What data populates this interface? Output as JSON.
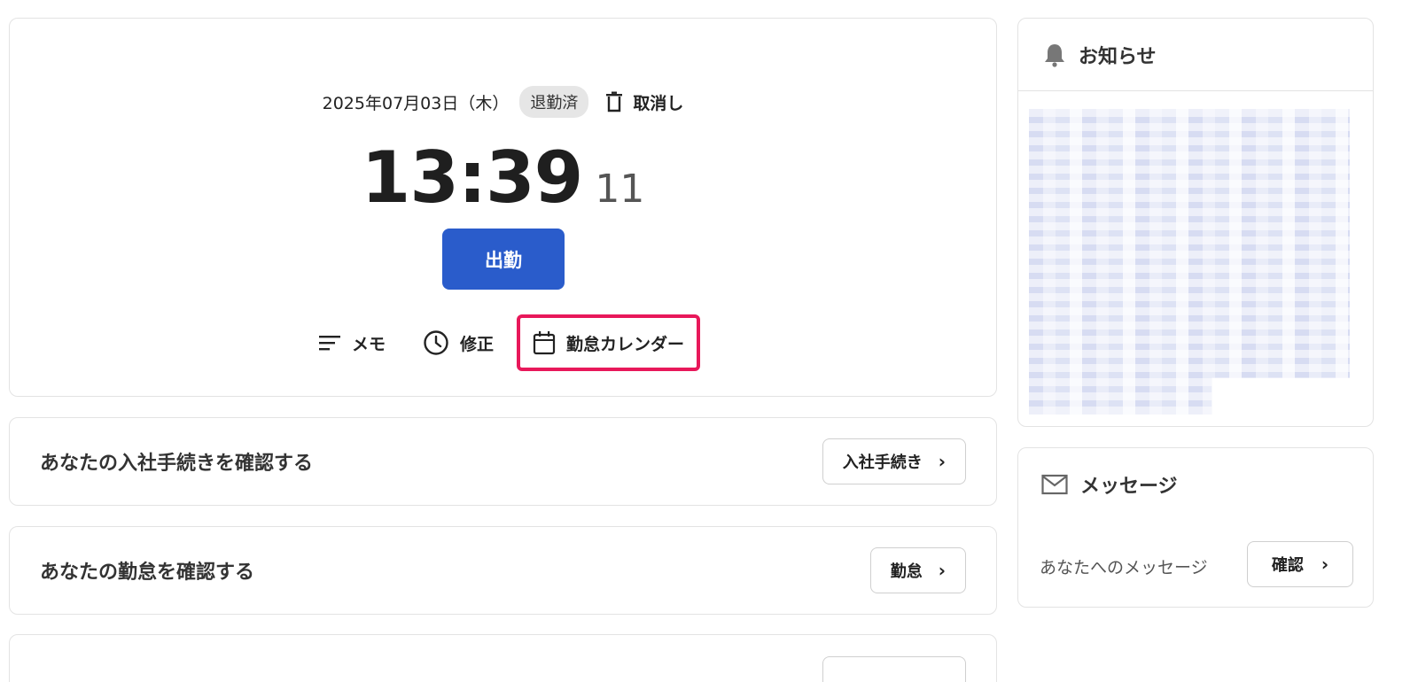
{
  "clock": {
    "date": "2025年07月03日（木）",
    "status": "退勤済",
    "cancel_label": "取消し",
    "time_main": "13:39",
    "time_seconds": "11",
    "clock_in_label": "出勤",
    "actions": {
      "memo": "メモ",
      "correction": "修正",
      "calendar": "勤怠カレンダー"
    }
  },
  "rows": {
    "onboarding": {
      "title": "あなたの入社手続きを確認する",
      "button": "入社手続き"
    },
    "attendance": {
      "title": "あなたの勤怠を確認する",
      "button": "勤怠"
    }
  },
  "notice": {
    "title": "お知らせ"
  },
  "message": {
    "title": "メッセージ",
    "text": "あなたへのメッセージ",
    "button": "確認"
  },
  "icons": {
    "cancel": "trash-icon",
    "memo": "lines-icon",
    "correction": "clock-icon",
    "calendar": "calendar-icon",
    "notice": "bell-icon",
    "message": "envelope-icon",
    "chevron": "chevron-right-icon"
  },
  "colors": {
    "primary": "#2a5ccb",
    "highlight": "#e8185a",
    "badge_bg": "#e6e6e6"
  }
}
